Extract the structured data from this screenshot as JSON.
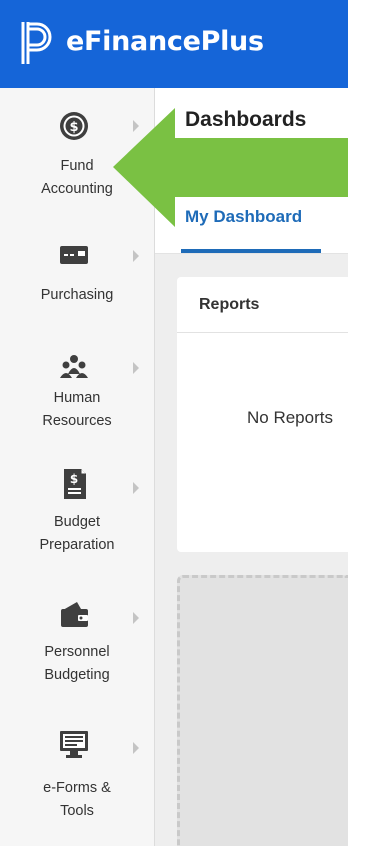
{
  "header": {
    "app_title": "eFinancePlus",
    "brand_color": "#1565d8"
  },
  "sidebar": {
    "items": [
      {
        "label": "Fund\nAccounting",
        "icon": "dollar-coin-icon"
      },
      {
        "label": "Purchasing",
        "icon": "credit-card-icon"
      },
      {
        "label": "Human\nResources",
        "icon": "people-group-icon"
      },
      {
        "label": "Budget\nPreparation",
        "icon": "dollar-document-icon"
      },
      {
        "label": "Personnel\nBudgeting",
        "icon": "wallet-icon"
      },
      {
        "label": "e-Forms &\nTools",
        "icon": "monitor-form-icon"
      }
    ]
  },
  "main": {
    "page_title": "Dashboards",
    "tabs": [
      {
        "label": "My Dashboard",
        "active": true
      }
    ],
    "reports": {
      "title": "Reports",
      "empty_text": "No Reports"
    }
  },
  "annotation": {
    "arrow_color": "#7ac143"
  }
}
